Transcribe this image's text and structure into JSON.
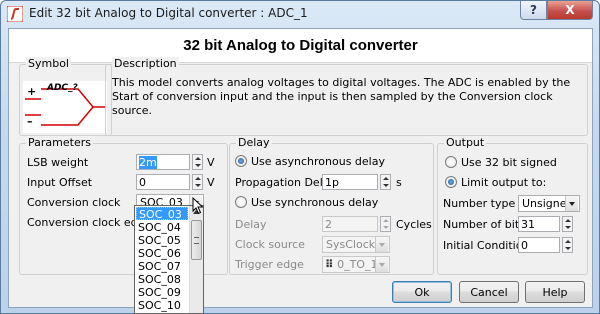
{
  "window": {
    "title": "Edit 32 bit Analog to Digital converter : ADC_1",
    "help_label": "?",
    "close_label": "X"
  },
  "header": {
    "title": "32 bit Analog to Digital converter"
  },
  "symbol": {
    "legend": "Symbol",
    "component_name": "ADC_?",
    "plus": "+",
    "minus": "–"
  },
  "description": {
    "legend": "Description",
    "text": "This model converts analog voltages to digital voltages. The ADC is enabled by the Start of conversion input and the input is then sampled by the Conversion clock source."
  },
  "parameters": {
    "legend": "Parameters",
    "lsb_label": "LSB weight",
    "lsb_value": "2m",
    "lsb_unit": "V",
    "offset_label": "Input Offset",
    "offset_value": "0",
    "offset_unit": "V",
    "clock_label": "Conversion clock",
    "clock_value": "SOC_03",
    "edge_label": "Conversion clock edge",
    "clock_options": [
      "SOC_03",
      "SOC_04",
      "SOC_05",
      "SOC_06",
      "SOC_07",
      "SOC_08",
      "SOC_09",
      "SOC_10"
    ]
  },
  "delay": {
    "legend": "Delay",
    "async_label": "Use asynchronous delay",
    "prop_label": "Propagation Delay",
    "prop_value": "1p",
    "prop_unit": "s",
    "sync_label": "Use synchronous delay",
    "delay_label": "Delay",
    "delay_value": "2",
    "delay_unit": "Cycles",
    "clock_source_label": "Clock source",
    "clock_source_value": "SysClock",
    "trigger_label": "Trigger edge",
    "trigger_value": "0_TO_1"
  },
  "output": {
    "legend": "Output",
    "signed_label": "Use 32 bit signed",
    "limit_label": "Limit output to:",
    "number_type_label": "Number type",
    "number_type_value": "Unsigned",
    "bits_label": "Number of bits",
    "bits_value": "31",
    "init_label": "Initial Condition",
    "init_value": "0"
  },
  "buttons": {
    "ok": "Ok",
    "cancel": "Cancel",
    "help": "Help"
  },
  "colors": {
    "accent": "#3399ff",
    "close": "#c75050",
    "symbol_red": "#d40000"
  }
}
